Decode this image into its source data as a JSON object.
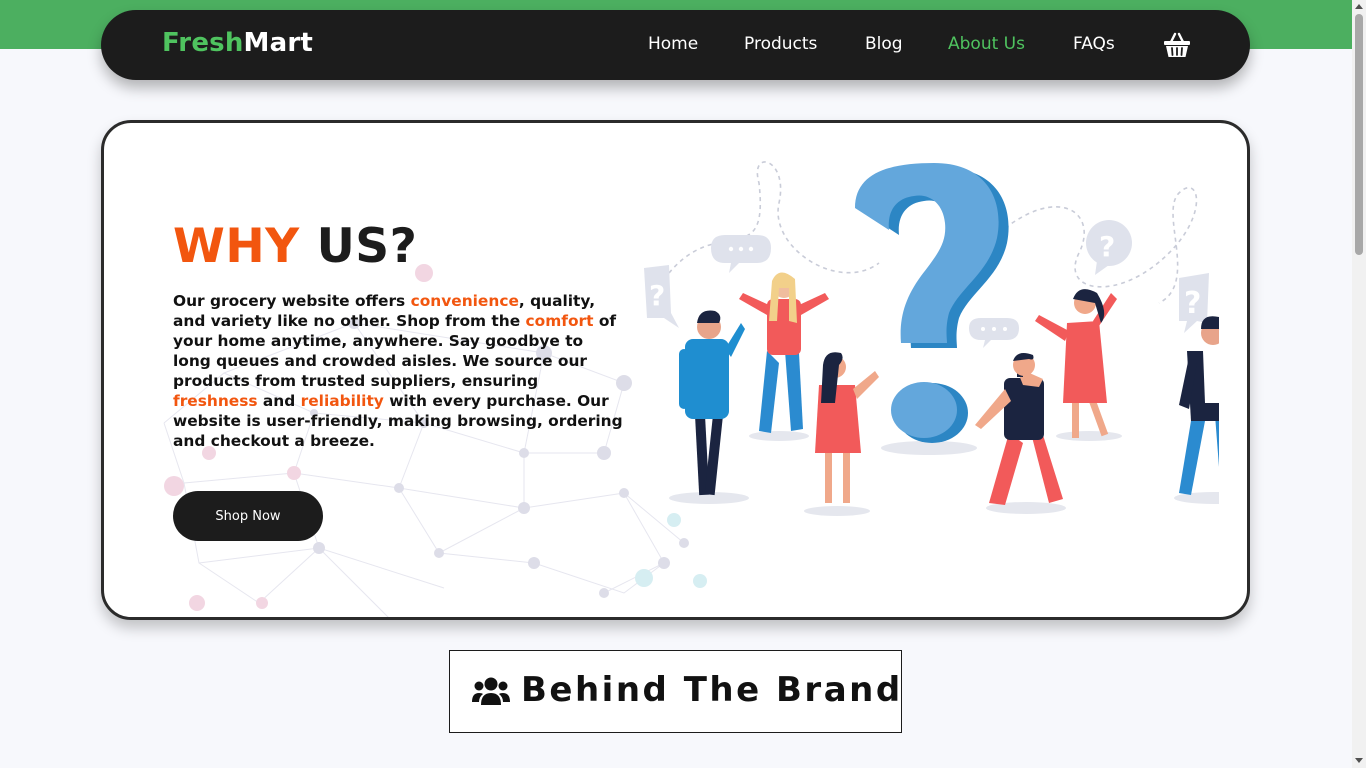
{
  "brand": {
    "name_part1": "Fresh",
    "name_part2": "Mart"
  },
  "nav": {
    "items": [
      {
        "label": "Home"
      },
      {
        "label": "Products"
      },
      {
        "label": "Blog"
      },
      {
        "label": "About Us",
        "active": true
      },
      {
        "label": "FAQs"
      }
    ],
    "cart_icon": "shopping-basket-icon"
  },
  "hero": {
    "title_part1": "WHY",
    "title_part2": "US?",
    "text_1": "Our grocery website offers ",
    "hl_1": "convenience",
    "text_2": ", quality, and variety like no other. Shop from the ",
    "hl_2": "comfort",
    "text_3": " of your home anytime, anywhere. Say goodbye to long queues and crowded aisles. We source our products from trusted suppliers, ensuring ",
    "hl_3": "freshness",
    "text_4": " and ",
    "hl_4": "reliability",
    "text_5": " with every purchase. Our website is user-friendly, making browsing, ordering and checkout a breeze.",
    "cta_label": "Shop Now",
    "illustration_icon": "question-people-illustration"
  },
  "section": {
    "title": "Behind The Brand",
    "icon": "users-icon"
  },
  "colors": {
    "accent_green": "#4fc35f",
    "top_band_green": "#4caf60",
    "accent_orange": "#f2560f",
    "dark": "#1c1c1c"
  }
}
